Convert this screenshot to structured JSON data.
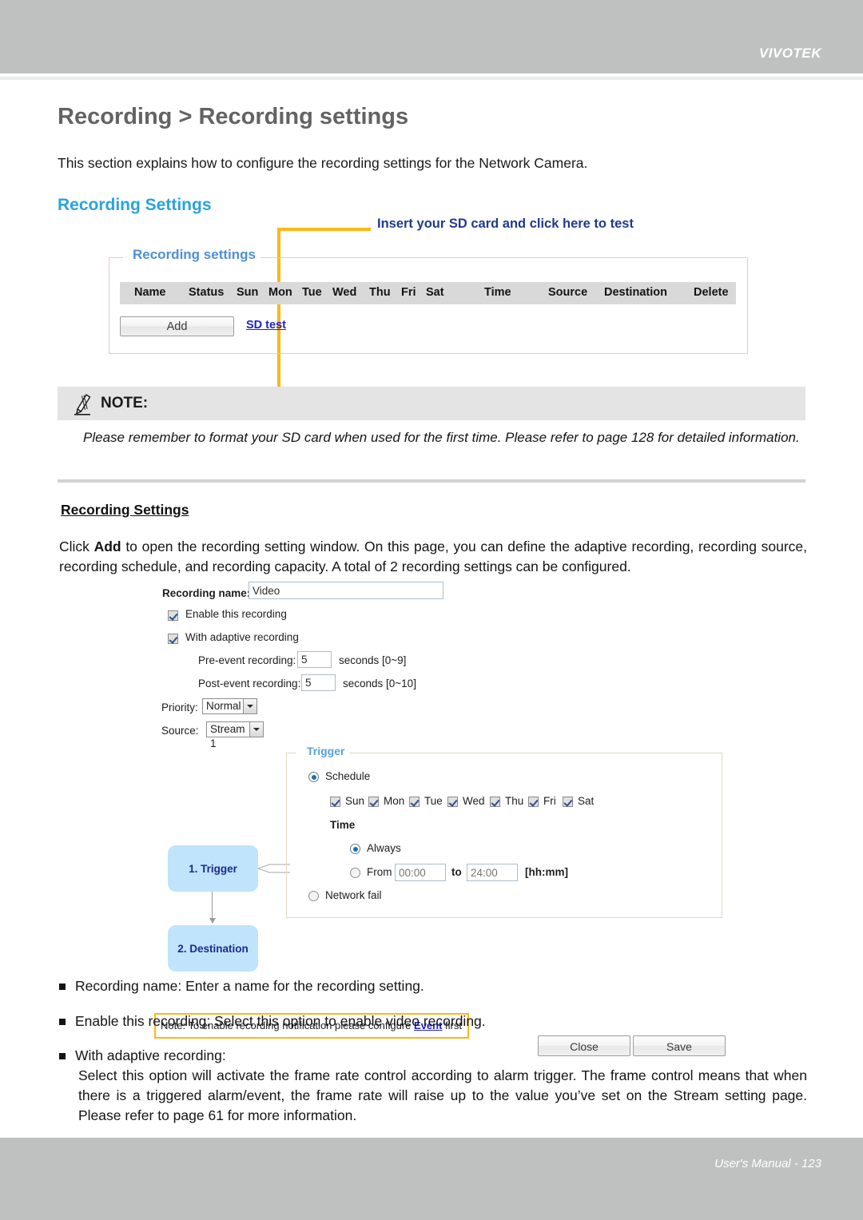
{
  "header": {
    "brand": "VIVOTEK"
  },
  "page": {
    "title": "Recording > Recording settings",
    "intro": "This section explains how to configure the recording settings for the Network Camera.",
    "section_heading": "Recording Settings"
  },
  "callout": {
    "text": "Insert your SD card and click here to test"
  },
  "recording_settings_panel": {
    "legend": "Recording settings",
    "columns": [
      "Name",
      "Status",
      "Sun",
      "Mon",
      "Tue",
      "Wed",
      "Thu",
      "Fri",
      "Sat",
      "Time",
      "Source",
      "Destination",
      "Delete"
    ],
    "rows": [],
    "add_button": "Add",
    "sd_test_link": "SD test"
  },
  "note": {
    "label": "NOTE:",
    "icon": "pencil-icon",
    "body": "Please remember to format your SD card when used for the first time. Please refer to page 128 for detailed information."
  },
  "sub_section": {
    "heading": "Recording Settings",
    "paragraph_pre": "Click ",
    "paragraph_bold": "Add",
    "paragraph_post": " to open the recording setting window. On this page, you can define the adaptive recording, recording source, recording schedule, and recording capacity. A total of 2 recording settings can be configured."
  },
  "dialog": {
    "recording_name_label": "Recording name:",
    "recording_name_value": "Video",
    "enable_recording_label": "Enable this recording",
    "enable_recording_checked": true,
    "adaptive_recording_label": "With adaptive recording",
    "adaptive_recording_checked": true,
    "pre_event_label": "Pre-event recording:",
    "pre_event_value": "5",
    "pre_event_units": "seconds [0~9]",
    "post_event_label": "Post-event recording:",
    "post_event_value": "5",
    "post_event_units": "seconds [0~10]",
    "priority_label": "Priority:",
    "priority_value": "Normal",
    "source_label": "Source:",
    "source_value": "Stream 1",
    "steps": [
      {
        "label": "1. Trigger"
      },
      {
        "label": "2. Destination"
      }
    ],
    "trigger": {
      "legend": "Trigger",
      "schedule_label": "Schedule",
      "schedule_selected": true,
      "days": [
        {
          "label": "Sun",
          "checked": true
        },
        {
          "label": "Mon",
          "checked": true
        },
        {
          "label": "Tue",
          "checked": true
        },
        {
          "label": "Wed",
          "checked": true
        },
        {
          "label": "Thu",
          "checked": true
        },
        {
          "label": "Fri",
          "checked": true
        },
        {
          "label": "Sat",
          "checked": true
        }
      ],
      "time_label": "Time",
      "always_label": "Always",
      "always_selected": true,
      "from_label": "From",
      "from_value": "00:00",
      "to_label": "to",
      "to_value": "24:00",
      "format_hint": "[hh:mm]",
      "network_fail_label": "Network fail",
      "network_fail_selected": false
    },
    "bottom_note_pre": "Note: To enable recording notification please configure ",
    "bottom_note_link": "Event",
    "bottom_note_post": " first",
    "close_button": "Close",
    "save_button": "Save"
  },
  "bullets": [
    {
      "text": "Recording name: Enter a name for the recording setting."
    },
    {
      "text": "Enable this recording: Select this option to enable video recording."
    },
    {
      "text": "With adaptive recording:",
      "continuation": "Select this option will activate the frame rate control according to alarm trigger. The frame control means that when there is a triggered alarm/event, the frame rate will raise up to the value you’ve set on the Stream setting page. Please refer to page 61 for more information."
    }
  ],
  "footer": {
    "text": "User's Manual - 123"
  },
  "colors": {
    "header_gray": "#bfc1c1",
    "accent_blue": "#29a3dc",
    "callout_orange": "#ffb617",
    "link_blue": "#2222cc",
    "step_box_blue": "#bfe4fb"
  }
}
